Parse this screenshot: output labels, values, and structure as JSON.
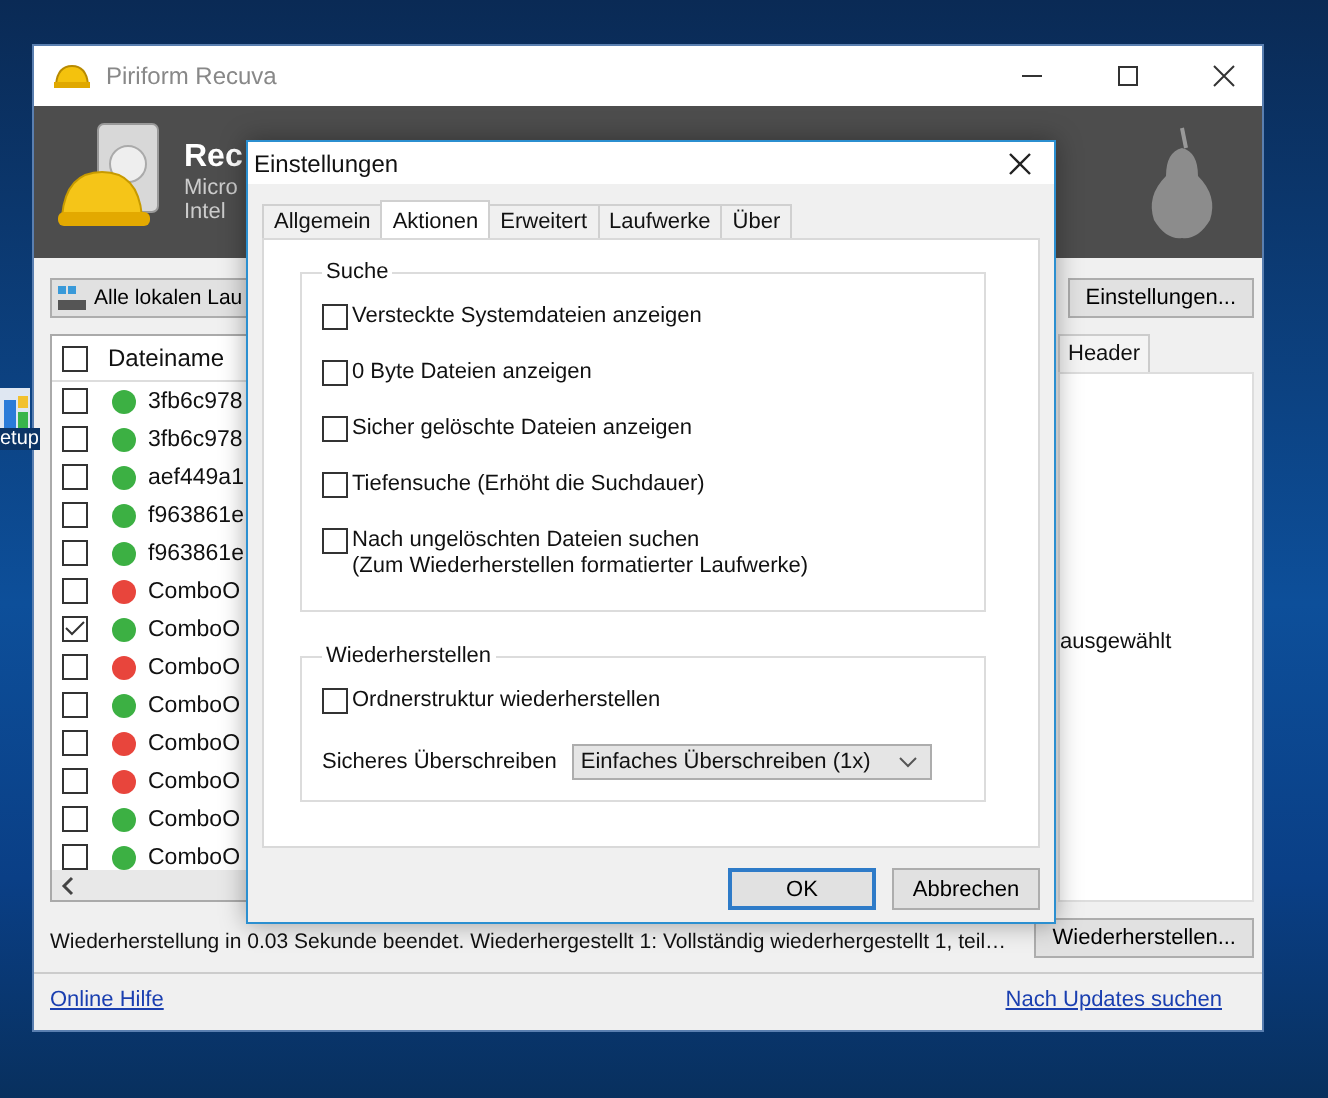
{
  "desktop": {
    "icon_label": "etup"
  },
  "window": {
    "title": "Piriform Recuva",
    "header_title": "Rec",
    "header_lines": [
      "Micro",
      "Intel"
    ]
  },
  "toolbar": {
    "drive_button": "Alle lokalen Lau",
    "settings_button": "Einstellungen..."
  },
  "table": {
    "columns": [
      "Dateiname"
    ],
    "header_checked": false,
    "rows": [
      {
        "name": "3fb6c978",
        "checked": false,
        "color": "#3cb043"
      },
      {
        "name": "3fb6c978",
        "checked": false,
        "color": "#3cb043"
      },
      {
        "name": "aef449a1",
        "checked": false,
        "color": "#3cb043"
      },
      {
        "name": "f963861e",
        "checked": false,
        "color": "#3cb043"
      },
      {
        "name": "f963861e",
        "checked": false,
        "color": "#3cb043"
      },
      {
        "name": "ComboO",
        "checked": false,
        "color": "#e8453c"
      },
      {
        "name": "ComboO",
        "checked": true,
        "color": "#3cb043"
      },
      {
        "name": "ComboO",
        "checked": false,
        "color": "#e8453c"
      },
      {
        "name": "ComboO",
        "checked": false,
        "color": "#3cb043"
      },
      {
        "name": "ComboO",
        "checked": false,
        "color": "#e8453c"
      },
      {
        "name": "ComboO",
        "checked": false,
        "color": "#e8453c"
      },
      {
        "name": "ComboO",
        "checked": false,
        "color": "#3cb043"
      },
      {
        "name": "ComboO",
        "checked": false,
        "color": "#3cb043"
      }
    ]
  },
  "side_panel": {
    "tab": "Header",
    "text": "ausgewählt"
  },
  "status": {
    "text": "Wiederherstellung in 0.03 Sekunde beendet. Wiederhergestellt 1: Vollständig wiederhergestellt 1, teil…",
    "button": "Wiederherstellen..."
  },
  "footer": {
    "help_link": "Online Hilfe",
    "update_link": "Nach Updates suchen"
  },
  "dialog": {
    "title": "Einstellungen",
    "tabs": [
      {
        "label": "Allgemein",
        "selected": false
      },
      {
        "label": "Aktionen",
        "selected": true
      },
      {
        "label": "Erweitert",
        "selected": false
      },
      {
        "label": "Laufwerke",
        "selected": false
      },
      {
        "label": "Über",
        "selected": false
      }
    ],
    "search_group": {
      "title": "Suche",
      "options": [
        {
          "label": "Versteckte Systemdateien anzeigen",
          "checked": false
        },
        {
          "label": "0 Byte Dateien anzeigen",
          "checked": false
        },
        {
          "label": "Sicher gelöschte Dateien anzeigen",
          "checked": false
        },
        {
          "label": "Tiefensuche (Erhöht die Suchdauer)",
          "checked": false
        },
        {
          "label": "Nach ungelöschten Dateien suchen\n(Zum Wiederherstellen formatierter Laufwerke)",
          "checked": false
        }
      ]
    },
    "restore_group": {
      "title": "Wiederherstellen",
      "options": [
        {
          "label": "Ordnerstruktur wiederherstellen",
          "checked": false
        }
      ],
      "overwrite_label": "Sicheres Überschreiben",
      "overwrite_value": "Einfaches Überschreiben (1x)"
    },
    "buttons": [
      {
        "label": "OK",
        "default": true
      },
      {
        "label": "Abbrechen",
        "default": false
      }
    ]
  }
}
